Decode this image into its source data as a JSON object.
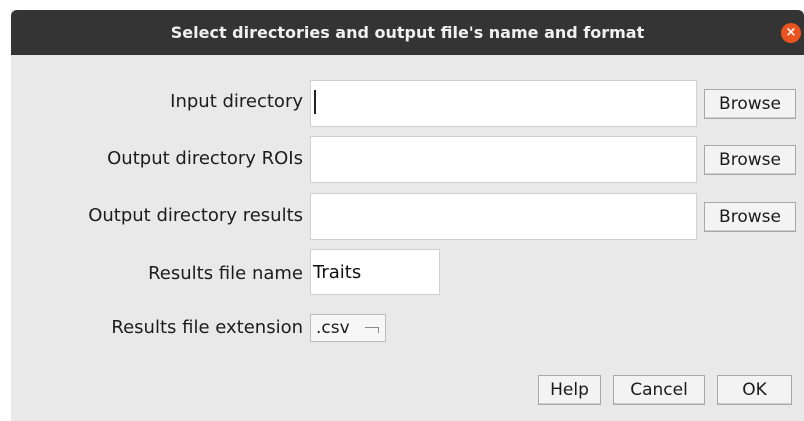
{
  "window": {
    "title": "Select directories and output file's name and format",
    "close_symbol": "×"
  },
  "form": {
    "input_directory": {
      "label": "Input directory",
      "value": "",
      "browse_label": "Browse"
    },
    "output_directory_rois": {
      "label": "Output directory ROIs",
      "value": "",
      "browse_label": "Browse"
    },
    "output_directory_results": {
      "label": "Output directory results",
      "value": "",
      "browse_label": "Browse"
    },
    "results_file_name": {
      "label": "Results file name",
      "value": "Traits"
    },
    "results_file_extension": {
      "label": "Results file extension",
      "selected": ".csv"
    }
  },
  "footer": {
    "help_label": "Help",
    "cancel_label": "Cancel",
    "ok_label": "OK"
  },
  "colors": {
    "titlebar": "#343434",
    "dialog_bg": "#e9e9e9",
    "close_button": "#e95420"
  },
  "icons": {
    "close": "close-icon",
    "dropdown": "dropdown-arrow-icon"
  }
}
